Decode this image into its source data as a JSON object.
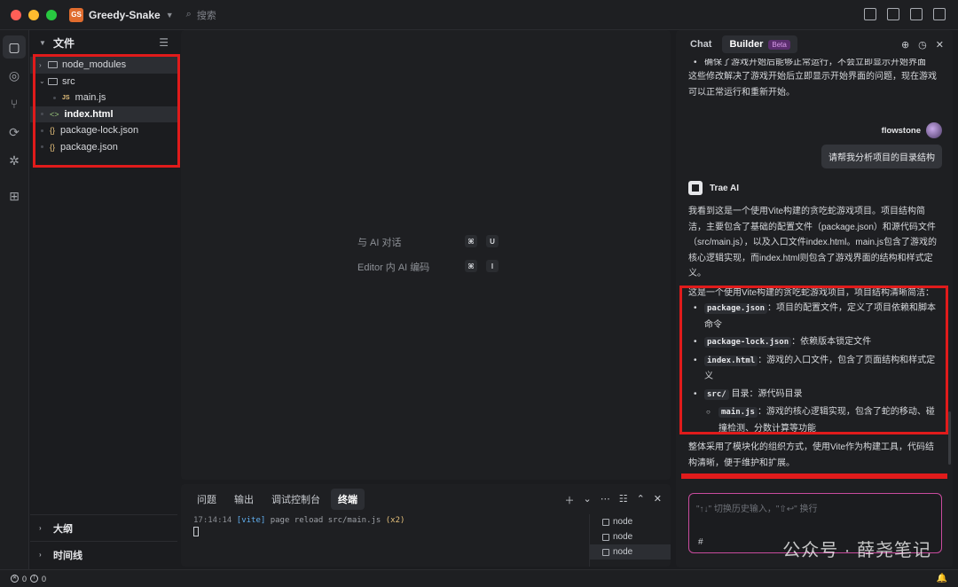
{
  "app": {
    "project_badge": "GS",
    "project_name": "Greedy-Snake",
    "search_placeholder": "搜索"
  },
  "explorer": {
    "title": "文件",
    "tree": [
      {
        "label": "node_modules",
        "kind": "folder",
        "collapsed": true
      },
      {
        "label": "src",
        "kind": "folder",
        "collapsed": false
      },
      {
        "label": "main.js",
        "kind": "js"
      },
      {
        "label": "index.html",
        "kind": "html",
        "selected": true
      },
      {
        "label": "package-lock.json",
        "kind": "json"
      },
      {
        "label": "package.json",
        "kind": "json"
      }
    ],
    "outline_label": "大纲",
    "timeline_label": "时间线"
  },
  "editor": {
    "hint_chat": "与 AI 对话",
    "hint_chat_keys": [
      "⌘",
      "U"
    ],
    "hint_code": "Editor 内 AI 编码",
    "hint_code_keys": [
      "⌘",
      "I"
    ]
  },
  "panel": {
    "tabs": [
      "问题",
      "输出",
      "调试控制台",
      "终端"
    ],
    "active_tab": "终端",
    "terminal_time": "17:14:14",
    "terminal_vite": "[vite]",
    "terminal_msg": "page reload src/main.js",
    "terminal_count": "(x2)",
    "terminals": [
      "node",
      "node",
      "node"
    ]
  },
  "chat": {
    "tab_chat": "Chat",
    "tab_builder": "Builder",
    "beta_badge": "Beta",
    "prev_bullet": "确保了游戏开始后能够正常运行，不会立即显示开始界面",
    "prev_summary": "这些修改解决了游戏开始后立即显示开始界面的问题，现在游戏可以正常运行和重新开始。",
    "user_name": "flowstone",
    "user_message": "请帮我分析项目的目录结构",
    "ai_name": "Trae AI",
    "ai_intro": "我看到这是一个使用Vite构建的贪吃蛇游戏项目。项目结构简洁，主要包含了基础的配置文件（package.json）和源代码文件（src/main.js），以及入口文件index.html。main.js包含了游戏的核心逻辑实现，而index.html则包含了游戏界面的结构和样式定义。",
    "ai_lead": "这是一个使用Vite构建的贪吃蛇游戏项目，项目结构清晰简洁：",
    "items": [
      {
        "code": "package.json",
        "text": "：项目的配置文件，定义了项目依赖和脚本命令"
      },
      {
        "code": "package-lock.json",
        "text": "：依赖版本锁定文件"
      },
      {
        "code": "index.html",
        "text": "：游戏的入口文件，包含了页面结构和样式定义"
      },
      {
        "code": "src/",
        "text": " 目录：源代码目录"
      }
    ],
    "sub_item": {
      "code": "main.js",
      "text": "：游戏的核心逻辑实现，包含了蛇的移动、碰撞检测、分数计算等功能"
    },
    "ai_outro": "整体采用了模块化的组织方式，使用Vite作为构建工具，代码结构清晰，便于维护和扩展。",
    "input_placeholder": "\"↑↓\" 切换历史输入，\"⇧↩\" 换行",
    "input_tools": "#"
  },
  "status": {
    "errors": "0",
    "warnings": "0"
  },
  "watermark": "公众号 · 薛尧笔记",
  "colors": {
    "highlight": "#e01b1b",
    "accent_pink": "#c94b9e"
  }
}
